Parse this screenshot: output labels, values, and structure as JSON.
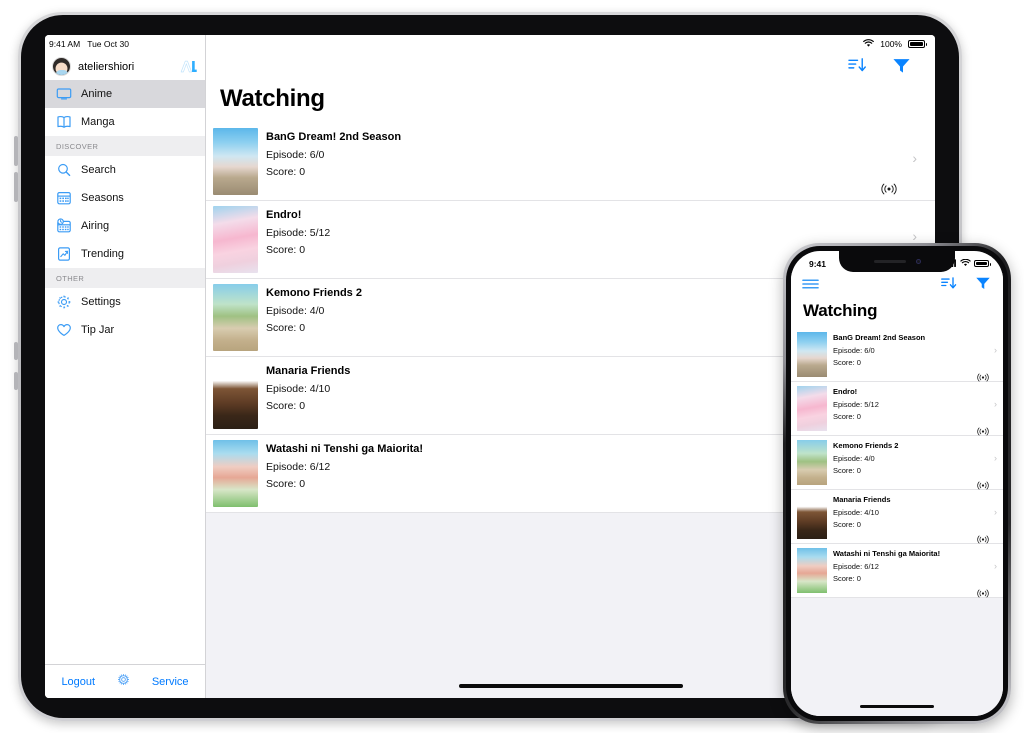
{
  "ipad": {
    "status_bar": {
      "time": "9:41 AM",
      "date": "Tue Oct 30",
      "battery_percent": "100%",
      "wifi_icon": "wifi-icon",
      "battery_icon": "battery-icon"
    },
    "account": {
      "name": "ateliershiori",
      "avatar_icon": "avatar",
      "service_logo_icon": "anilist-logo-icon"
    },
    "sidebar": {
      "groups": [
        {
          "header": "",
          "items": [
            {
              "label": "Anime",
              "icon": "tv-icon",
              "selected": true
            },
            {
              "label": "Manga",
              "icon": "book-icon",
              "selected": false
            }
          ]
        },
        {
          "header": "DISCOVER",
          "items": [
            {
              "label": "Search",
              "icon": "search-icon",
              "selected": false
            },
            {
              "label": "Seasons",
              "icon": "calendar-icon",
              "selected": false
            },
            {
              "label": "Airing",
              "icon": "calendar-clock-icon",
              "selected": false
            },
            {
              "label": "Trending",
              "icon": "trending-chart-icon",
              "selected": false
            }
          ]
        },
        {
          "header": "OTHER",
          "items": [
            {
              "label": "Settings",
              "icon": "gear-icon",
              "selected": false
            },
            {
              "label": "Tip Jar",
              "icon": "heart-icon",
              "selected": false
            }
          ]
        }
      ],
      "toolbar": {
        "logout_label": "Logout",
        "settings_icon": "gear-flower-icon",
        "service_label": "Service"
      }
    },
    "main": {
      "title": "Watching",
      "toolbar": {
        "sort_icon": "sort-descending-icon",
        "filter_icon": "filter-funnel-icon"
      },
      "home_indicator": "home-indicator"
    }
  },
  "iphone": {
    "status_bar": {
      "time": "9:41",
      "signal_icon": "cellular-signal-icon",
      "wifi_icon": "wifi-icon",
      "battery_icon": "battery-icon"
    },
    "navbar": {
      "menu_icon": "hamburger-menu-icon",
      "sort_icon": "sort-descending-icon",
      "filter_icon": "filter-funnel-icon"
    },
    "title": "Watching",
    "home_indicator": "home-indicator"
  },
  "labels": {
    "episode_prefix": "Episode: ",
    "score_prefix": "Score: ",
    "chevron_glyph": "›",
    "airing_icon": "airing-broadcast-icon"
  },
  "list": [
    {
      "title": "BanG Dream! 2nd Season",
      "episode": "Episode: 6/0",
      "score": "Score: 0",
      "airing": true,
      "cover": "bang-dream-2nd-season-cover"
    },
    {
      "title": "Endro!",
      "episode": "Episode: 5/12",
      "score": "Score: 0",
      "airing": true,
      "cover": "endro-cover"
    },
    {
      "title": "Kemono Friends 2",
      "episode": "Episode: 4/0",
      "score": "Score: 0",
      "airing": true,
      "cover": "kemono-friends-2-cover"
    },
    {
      "title": "Manaria Friends",
      "episode": "Episode: 4/10",
      "score": "Score: 0",
      "airing": true,
      "cover": "manaria-friends-cover"
    },
    {
      "title": "Watashi ni Tenshi ga Maiorita!",
      "episode": "Episode: 6/12",
      "score": "Score: 0",
      "airing": true,
      "cover": "watashi-ni-tenshi-ga-maiorita-cover"
    }
  ],
  "colors": {
    "accent": "#007aff",
    "selected_row": "#d8d8dc",
    "section_header_bg": "#eeeef0",
    "page_bg": "#f2f2f6",
    "separator": "#e3e3e6",
    "chevron": "#c4c4c6"
  }
}
